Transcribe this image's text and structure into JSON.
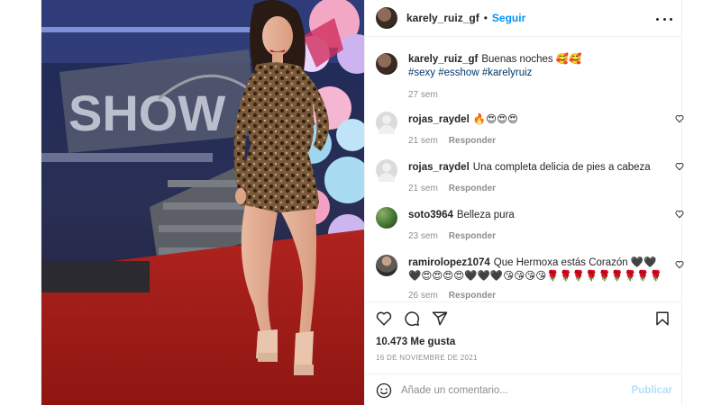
{
  "post": {
    "username": "karely_ruiz_gf",
    "follow_label": "Seguir",
    "caption": {
      "username": "karely_ruiz_gf",
      "text": "Buenas noches 🥰🥰",
      "hashtags": "#sexy #esshow #karelyruiz",
      "time": "27 sem"
    },
    "comments": [
      {
        "username": "rojas_raydel",
        "text": "🔥😍😍😍",
        "time": "21 sem",
        "reply": "Responder"
      },
      {
        "username": "rojas_raydel",
        "text": "Una completa delicia de pies a cabeza",
        "time": "21 sem",
        "reply": "Responder"
      },
      {
        "username": "soto3964",
        "text": "Belleza pura",
        "time": "23 sem",
        "reply": "Responder"
      },
      {
        "username": "ramirolopez1074",
        "text": "Que Hermoxa estás Corazón 🖤🖤🖤😍😍😍😍🖤🖤🖤😘😘😘😘🌹🌹🌹🌹🌹🌹🌹🌹🌹",
        "time": "26 sem",
        "reply": "Responder"
      }
    ],
    "likes": "10.473 Me gusta",
    "date": "16 DE NOVIEMBRE DE 2021",
    "comment_placeholder": "Añade un comentario...",
    "publish_label": "Publicar",
    "colors": {
      "accent": "#0095f6",
      "publish_disabled": "#b2dffc",
      "hashtag": "#00376b",
      "secondary_text": "#8e8e8e"
    },
    "icons": [
      "more-options-icon",
      "like-heart-icon",
      "comment-icon",
      "share-icon",
      "save-bookmark-icon",
      "emoji-icon",
      "comment-like-heart-icon"
    ]
  }
}
